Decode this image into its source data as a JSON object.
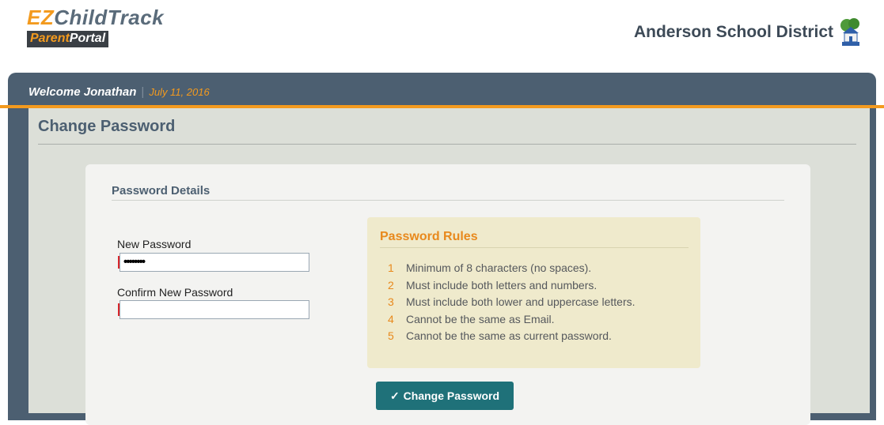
{
  "header": {
    "logo_ez": "EZ",
    "logo_childtrack": "ChildTrack",
    "logo_parent": "Parent",
    "logo_portal": "Portal",
    "district_name": "Anderson School District",
    "district_logo_icon": "school-house-icon"
  },
  "welcome": {
    "text": "Welcome Jonathan",
    "separator": "|",
    "date": "July 11, 2016"
  },
  "page": {
    "title": "Change Password"
  },
  "form": {
    "section_title": "Password Details",
    "new_password_label": "New Password",
    "new_password_value": "••••••••",
    "confirm_password_label": "Confirm New Password",
    "confirm_password_value": ""
  },
  "rules": {
    "title": "Password Rules",
    "items": [
      {
        "num": "1",
        "text": "Minimum of 8 characters (no spaces)."
      },
      {
        "num": "2",
        "text": "Must include both letters and numbers."
      },
      {
        "num": "3",
        "text": "Must include both lower and uppercase letters."
      },
      {
        "num": "4",
        "text": "Cannot be the same as Email."
      },
      {
        "num": "5",
        "text": "Cannot be the same as current password."
      }
    ]
  },
  "button": {
    "icon": "check-icon",
    "check_glyph": "✓",
    "label": "Change Password"
  },
  "colors": {
    "accent_orange": "#f39a1e",
    "frame_slate": "#4c5f71",
    "button_teal": "#1f7179",
    "rules_bg": "#efeacc"
  }
}
